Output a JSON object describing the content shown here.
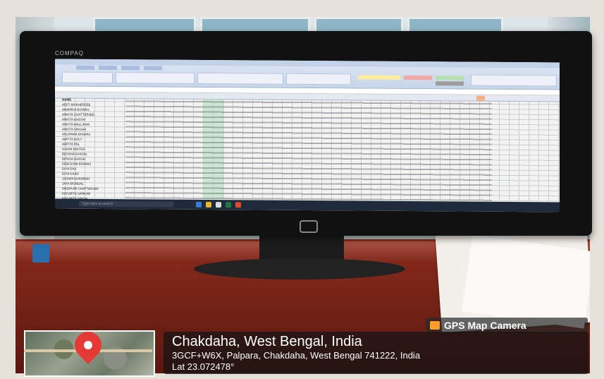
{
  "monitor": {
    "brand": "COMPAQ"
  },
  "screen": {
    "app": "Microsoft Excel",
    "taskbar_search": "Type here to search",
    "names": [
      "NAME",
      "ADITI MUKHERJEE",
      "ANAMIKA BISWAS",
      "ANKITA CHATTERJEE",
      "ANKITA GHOSH",
      "ANKITA MALLIKAR",
      "ANKITA SINGHA",
      "ANUPAMA BISWAS",
      "ARPITA KOLY",
      "ARPITA PAL",
      "ASHIM MAITRA",
      "BIDISHA GHOSH",
      "BIPASA GHOSH",
      "DEBOLINA BISWAS",
      "DIYA DAS",
      "DIYA KHAN",
      "JASIMA KHANRAH",
      "JAYA MONDAL",
      "MADHUMI CHATTERJEE",
      "MOUMITA SARKAR",
      "MOUMITA SINGH"
    ]
  },
  "overlay": {
    "badge": "GPS Map Camera",
    "title": "Chakdaha, West Bengal, India",
    "address": "3GCF+W6X, Palpara, Chakdaha, West Bengal 741222, India",
    "lat": "Lat 23.072478°"
  }
}
